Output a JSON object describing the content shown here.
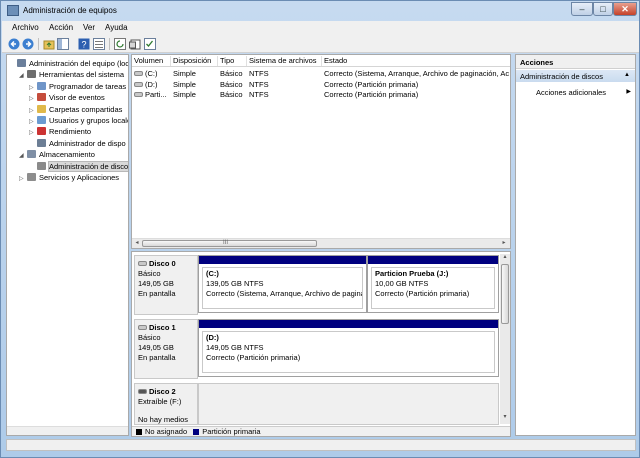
{
  "window": {
    "title": "Administración de equipos",
    "min": "–",
    "max": "□",
    "close": "✕"
  },
  "menu": [
    "Archivo",
    "Acción",
    "Ver",
    "Ayuda"
  ],
  "tree": {
    "items": [
      {
        "label": "Administración del equipo (loc",
        "indent": 0,
        "exp": "",
        "icon": "#6b7f9b"
      },
      {
        "label": "Herramientas del sistema",
        "indent": 1,
        "exp": "◢",
        "icon": "#6e6e6e"
      },
      {
        "label": "Programador de tareas",
        "indent": 2,
        "exp": "▷",
        "icon": "#6f95c8"
      },
      {
        "label": "Visor de eventos",
        "indent": 2,
        "exp": "▷",
        "icon": "#c54d3c"
      },
      {
        "label": "Carpetas compartidas",
        "indent": 2,
        "exp": "▷",
        "icon": "#e0b94a"
      },
      {
        "label": "Usuarios y grupos locale",
        "indent": 2,
        "exp": "▷",
        "icon": "#6b9bd1"
      },
      {
        "label": "Rendimiento",
        "indent": 2,
        "exp": "▷",
        "icon": "#cc3333"
      },
      {
        "label": "Administrador de dispo",
        "indent": 2,
        "exp": "",
        "icon": "#6c7e95"
      },
      {
        "label": "Almacenamiento",
        "indent": 1,
        "exp": "◢",
        "icon": "#7f8fa5"
      },
      {
        "label": "Administración de disco",
        "indent": 2,
        "exp": "",
        "icon": "#8a8a8a"
      },
      {
        "label": "Servicios y Aplicaciones",
        "indent": 1,
        "exp": "▷",
        "icon": "#8d8d8d"
      }
    ]
  },
  "volumes": {
    "columns": [
      "Volumen",
      "Disposición",
      "Tipo",
      "Sistema de archivos",
      "Estado"
    ],
    "rows": [
      [
        "(C:)",
        "Simple",
        "Básico",
        "NTFS",
        "Correcto (Sistema, Arranque, Archivo de paginación, Ac"
      ],
      [
        "(D:)",
        "Simple",
        "Básico",
        "NTFS",
        "Correcto (Partición primaria)"
      ],
      [
        "Parti...",
        "Simple",
        "Básico",
        "NTFS",
        "Correcto (Partición primaria)"
      ]
    ],
    "scroll_mid": "III"
  },
  "disks": [
    {
      "name": "Disco 0",
      "type": "Básico",
      "size": "149,05 GB",
      "state": "En pantalla",
      "partitions": [
        {
          "name": "(C:)",
          "size": "139,05 GB NTFS",
          "status": "Correcto (Sistema, Arranque, Archivo de pagina"
        },
        {
          "name": "Particion Prueba  (J:)",
          "size": "10,00 GB NTFS",
          "status": "Correcto (Partición primaria)"
        }
      ]
    },
    {
      "name": "Disco 1",
      "type": "Básico",
      "size": "149,05 GB",
      "state": "En pantalla",
      "partitions": [
        {
          "name": "(D:)",
          "size": "149,05 GB NTFS",
          "status": "Correcto (Partición primaria)"
        }
      ]
    },
    {
      "name": "Disco 2",
      "type": "Extraíble (F:)",
      "state": "No hay medios"
    }
  ],
  "legend": {
    "unallocated": "No asignado",
    "primary": "Partición primaria",
    "unallocated_color": "#000000",
    "primary_color": "#00007f"
  },
  "actions": {
    "header": "Acciones",
    "section": "Administración de discos",
    "more": "Acciones adicionales",
    "collapse": "▲",
    "more_arrow": "▶"
  }
}
